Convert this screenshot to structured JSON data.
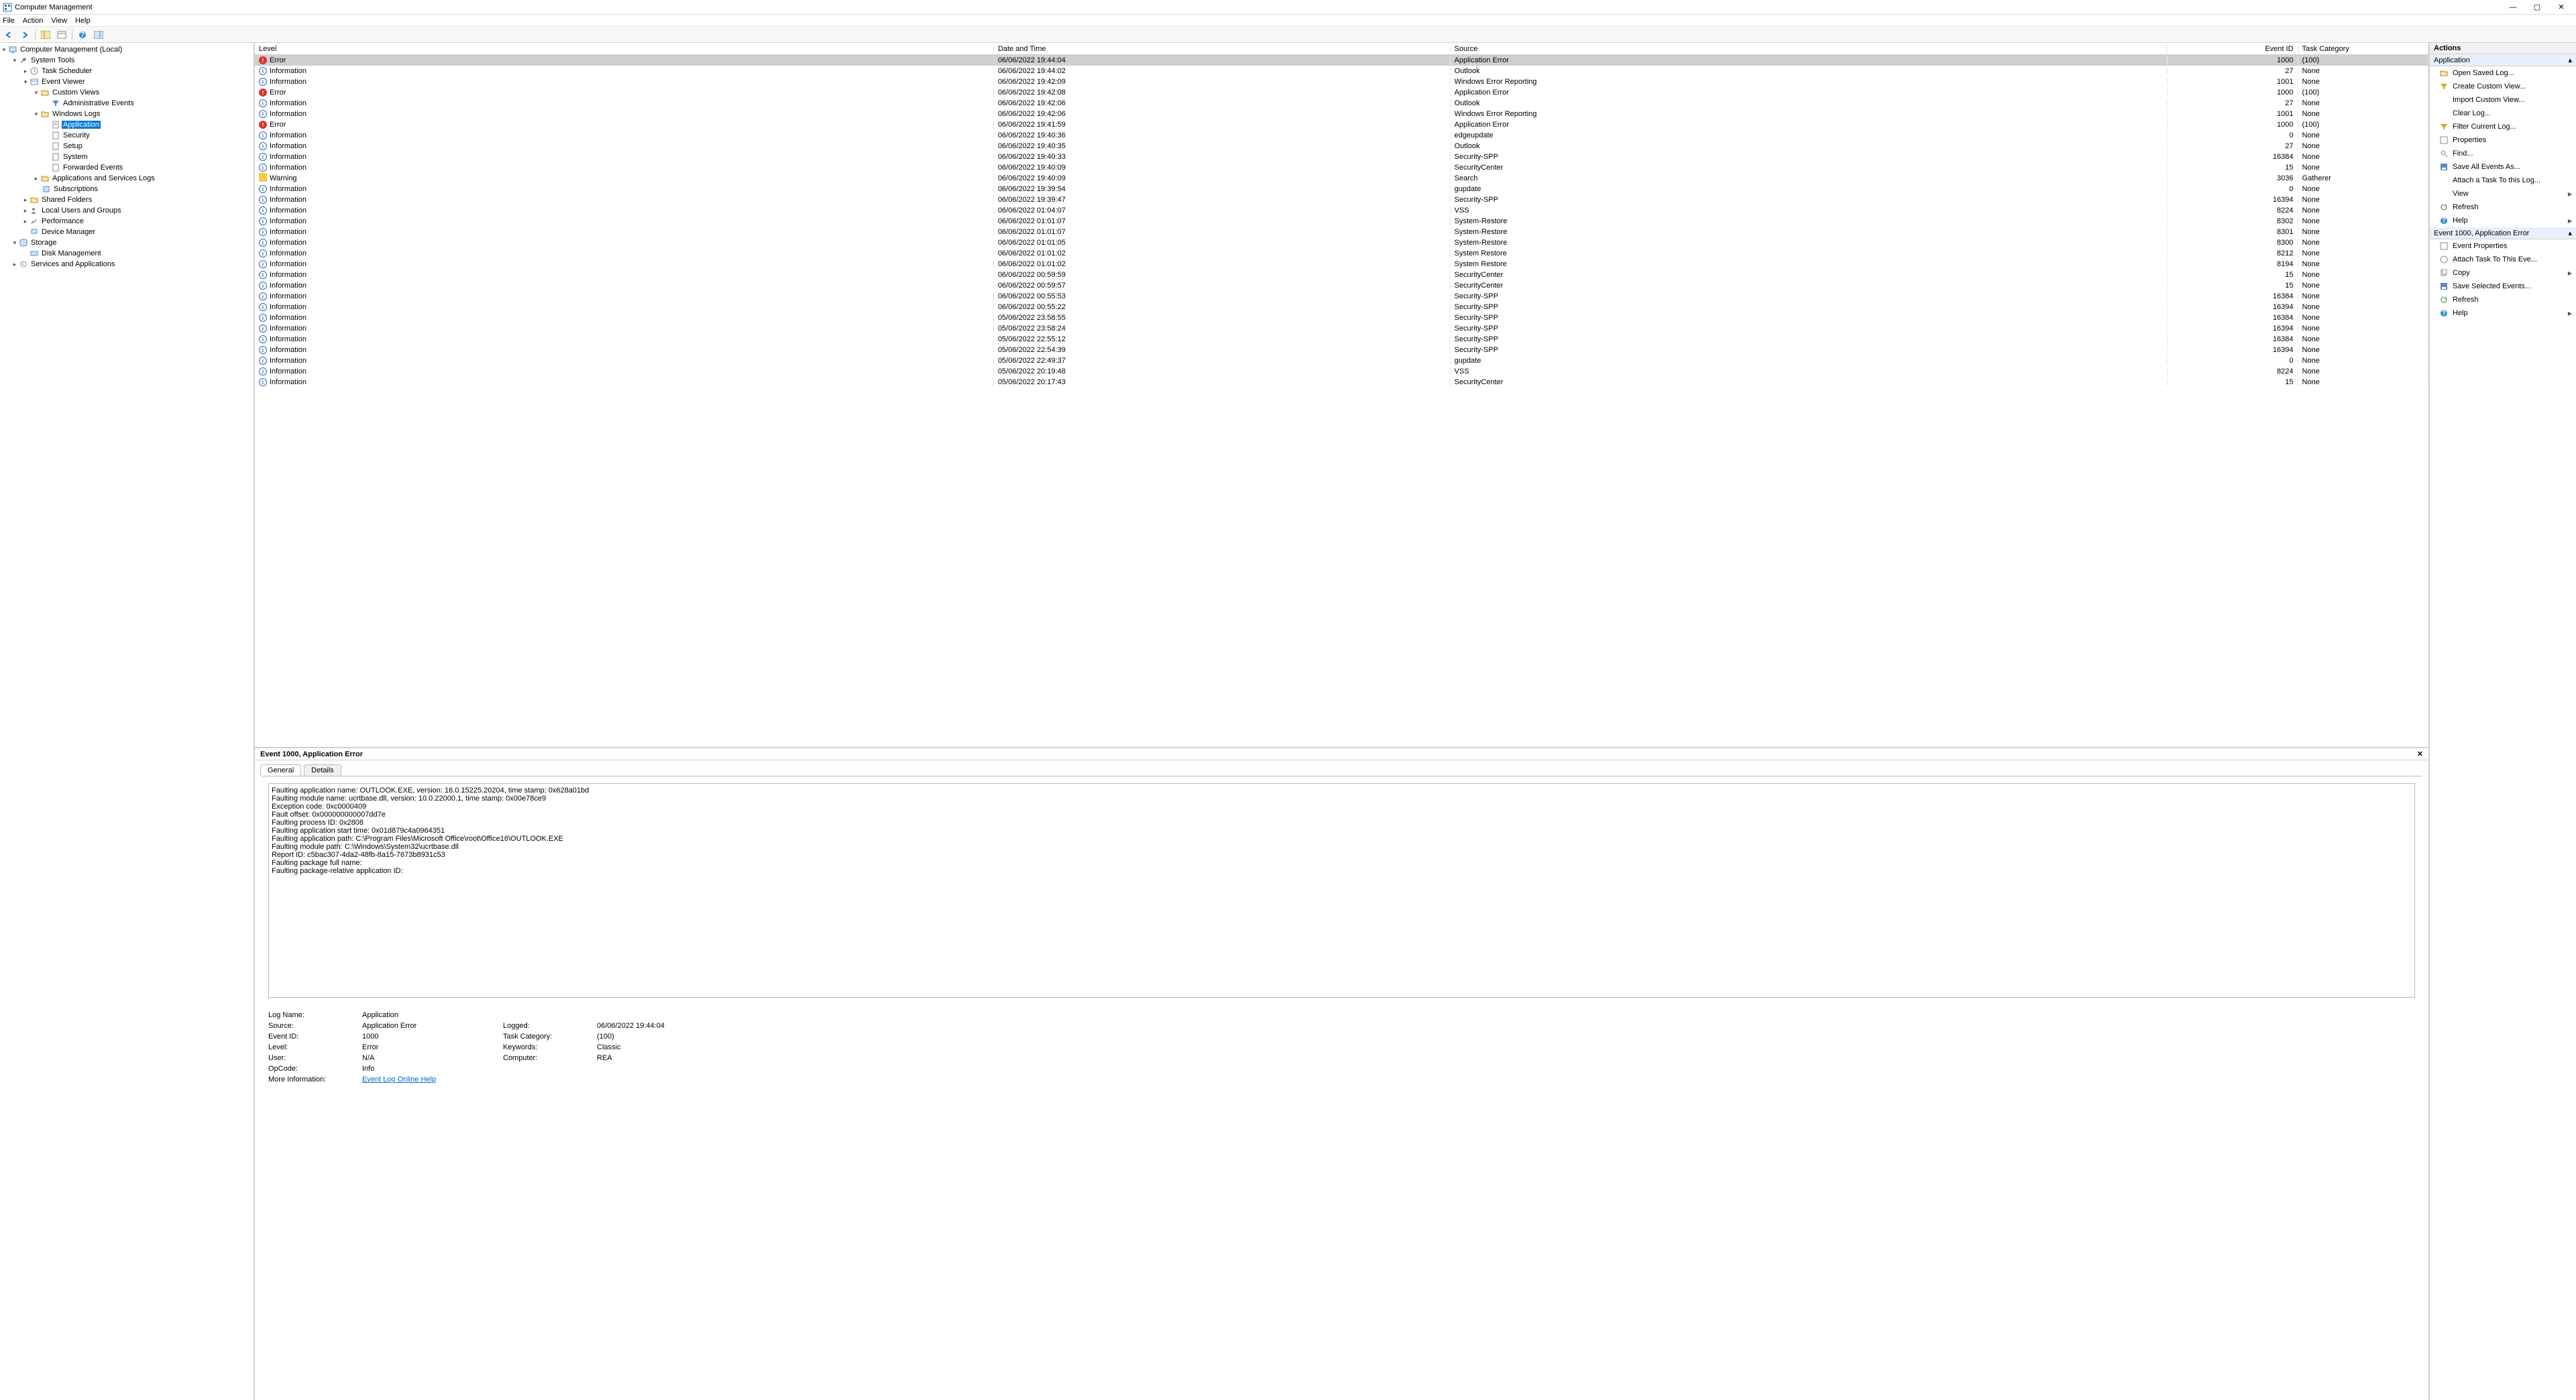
{
  "window": {
    "title": "Computer Management"
  },
  "menubar": [
    "File",
    "Action",
    "View",
    "Help"
  ],
  "tree": {
    "root": "Computer Management (Local)",
    "system_tools": "System Tools",
    "task_scheduler": "Task Scheduler",
    "event_viewer": "Event Viewer",
    "custom_views": "Custom Views",
    "admin_events": "Administrative Events",
    "windows_logs": "Windows Logs",
    "application": "Application",
    "security": "Security",
    "setup": "Setup",
    "system": "System",
    "forwarded": "Forwarded Events",
    "app_services_logs": "Applications and Services Logs",
    "subscriptions": "Subscriptions",
    "shared_folders": "Shared Folders",
    "local_users": "Local Users and Groups",
    "performance": "Performance",
    "device_manager": "Device Manager",
    "storage": "Storage",
    "disk_management": "Disk Management",
    "services_apps": "Services and Applications"
  },
  "columns": {
    "level": "Level",
    "date": "Date and Time",
    "source": "Source",
    "eventid": "Event ID",
    "task": "Task Category"
  },
  "events": [
    {
      "level": "Error",
      "date": "06/06/2022 19:44:04",
      "source": "Application Error",
      "id": "1000",
      "task": "(100)",
      "sel": true
    },
    {
      "level": "Information",
      "date": "06/06/2022 19:44:02",
      "source": "Outlook",
      "id": "27",
      "task": "None"
    },
    {
      "level": "Information",
      "date": "06/06/2022 19:42:09",
      "source": "Windows Error Reporting",
      "id": "1001",
      "task": "None"
    },
    {
      "level": "Error",
      "date": "06/06/2022 19:42:08",
      "source": "Application Error",
      "id": "1000",
      "task": "(100)"
    },
    {
      "level": "Information",
      "date": "06/06/2022 19:42:06",
      "source": "Outlook",
      "id": "27",
      "task": "None"
    },
    {
      "level": "Information",
      "date": "06/06/2022 19:42:06",
      "source": "Windows Error Reporting",
      "id": "1001",
      "task": "None"
    },
    {
      "level": "Error",
      "date": "06/06/2022 19:41:59",
      "source": "Application Error",
      "id": "1000",
      "task": "(100)"
    },
    {
      "level": "Information",
      "date": "06/06/2022 19:40:36",
      "source": "edgeupdate",
      "id": "0",
      "task": "None"
    },
    {
      "level": "Information",
      "date": "06/06/2022 19:40:35",
      "source": "Outlook",
      "id": "27",
      "task": "None"
    },
    {
      "level": "Information",
      "date": "06/06/2022 19:40:33",
      "source": "Security-SPP",
      "id": "16384",
      "task": "None"
    },
    {
      "level": "Information",
      "date": "06/06/2022 19:40:09",
      "source": "SecurityCenter",
      "id": "15",
      "task": "None"
    },
    {
      "level": "Warning",
      "date": "06/06/2022 19:40:09",
      "source": "Search",
      "id": "3036",
      "task": "Gatherer"
    },
    {
      "level": "Information",
      "date": "06/06/2022 19:39:54",
      "source": "gupdate",
      "id": "0",
      "task": "None"
    },
    {
      "level": "Information",
      "date": "06/06/2022 19:39:47",
      "source": "Security-SPP",
      "id": "16394",
      "task": "None"
    },
    {
      "level": "Information",
      "date": "06/06/2022 01:04:07",
      "source": "VSS",
      "id": "8224",
      "task": "None"
    },
    {
      "level": "Information",
      "date": "06/06/2022 01:01:07",
      "source": "System-Restore",
      "id": "8302",
      "task": "None"
    },
    {
      "level": "Information",
      "date": "06/06/2022 01:01:07",
      "source": "System-Restore",
      "id": "8301",
      "task": "None"
    },
    {
      "level": "Information",
      "date": "06/06/2022 01:01:05",
      "source": "System-Restore",
      "id": "8300",
      "task": "None"
    },
    {
      "level": "Information",
      "date": "06/06/2022 01:01:02",
      "source": "System Restore",
      "id": "8212",
      "task": "None"
    },
    {
      "level": "Information",
      "date": "06/06/2022 01:01:02",
      "source": "System Restore",
      "id": "8194",
      "task": "None"
    },
    {
      "level": "Information",
      "date": "06/06/2022 00:59:59",
      "source": "SecurityCenter",
      "id": "15",
      "task": "None"
    },
    {
      "level": "Information",
      "date": "06/06/2022 00:59:57",
      "source": "SecurityCenter",
      "id": "15",
      "task": "None"
    },
    {
      "level": "Information",
      "date": "06/06/2022 00:55:53",
      "source": "Security-SPP",
      "id": "16384",
      "task": "None"
    },
    {
      "level": "Information",
      "date": "06/06/2022 00:55:22",
      "source": "Security-SPP",
      "id": "16394",
      "task": "None"
    },
    {
      "level": "Information",
      "date": "05/06/2022 23:58:55",
      "source": "Security-SPP",
      "id": "16384",
      "task": "None"
    },
    {
      "level": "Information",
      "date": "05/06/2022 23:58:24",
      "source": "Security-SPP",
      "id": "16394",
      "task": "None"
    },
    {
      "level": "Information",
      "date": "05/06/2022 22:55:12",
      "source": "Security-SPP",
      "id": "16384",
      "task": "None"
    },
    {
      "level": "Information",
      "date": "05/06/2022 22:54:39",
      "source": "Security-SPP",
      "id": "16394",
      "task": "None"
    },
    {
      "level": "Information",
      "date": "05/06/2022 22:49:37",
      "source": "gupdate",
      "id": "0",
      "task": "None"
    },
    {
      "level": "Information",
      "date": "05/06/2022 20:19:48",
      "source": "VSS",
      "id": "8224",
      "task": "None"
    },
    {
      "level": "Information",
      "date": "05/06/2022 20:17:43",
      "source": "SecurityCenter",
      "id": "15",
      "task": "None"
    }
  ],
  "details": {
    "header": "Event 1000, Application Error",
    "tab_general": "General",
    "tab_details": "Details",
    "description": "Faulting application name: OUTLOOK.EXE, version: 16.0.15225.20204, time stamp: 0x628a01bd\nFaulting module name: ucrtbase.dll, version: 10.0.22000.1, time stamp: 0x00e78ce9\nException code: 0xc0000409\nFault offset: 0x000000000007dd7e\nFaulting process ID: 0x2808\nFaulting application start time: 0x01d879c4a0964351\nFaulting application path: C:\\Program Files\\Microsoft Office\\root\\Office16\\OUTLOOK.EXE\nFaulting module path: C:\\Windows\\System32\\ucrtbase.dll\nReport ID: c5bac307-4da2-48fb-8a15-7673b8931c53\nFaulting package full name:\nFaulting package-relative application ID:",
    "meta": {
      "log_name_lbl": "Log Name:",
      "log_name": "Application",
      "source_lbl": "Source:",
      "source": "Application Error",
      "logged_lbl": "Logged:",
      "logged": "06/06/2022 19:44:04",
      "eventid_lbl": "Event ID:",
      "eventid": "1000",
      "task_lbl": "Task Category:",
      "task": "(100)",
      "level_lbl": "Level:",
      "level": "Error",
      "keywords_lbl": "Keywords:",
      "keywords": "Classic",
      "user_lbl": "User:",
      "user": "N/A",
      "computer_lbl": "Computer:",
      "computer": "REA",
      "opcode_lbl": "OpCode:",
      "opcode": "Info",
      "moreinfo_lbl": "More Information:",
      "moreinfo_link": "Event Log Online Help"
    }
  },
  "actions": {
    "header": "Actions",
    "group1": "Application",
    "open_saved": "Open Saved Log...",
    "create_custom": "Create Custom View...",
    "import_custom": "Import Custom View...",
    "clear_log": "Clear Log...",
    "filter_log": "Filter Current Log...",
    "properties": "Properties",
    "find": "Find...",
    "save_all": "Save All Events As...",
    "attach_task": "Attach a Task To this Log...",
    "view": "View",
    "refresh": "Refresh",
    "help": "Help",
    "group2": "Event 1000, Application Error",
    "event_props": "Event Properties",
    "attach_task2": "Attach Task To This Eve...",
    "copy": "Copy",
    "save_selected": "Save Selected Events...",
    "refresh2": "Refresh",
    "help2": "Help"
  }
}
